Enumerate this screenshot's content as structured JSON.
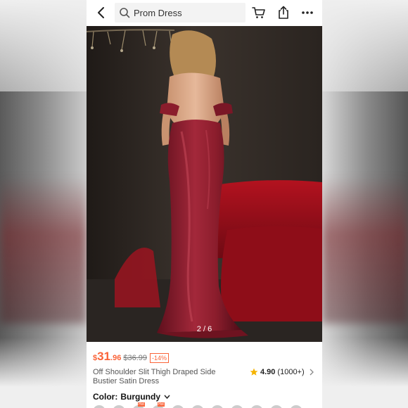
{
  "search": {
    "placeholder": "Prom Dress",
    "value": "Prom Dress"
  },
  "icons": {
    "back": "back-arrow-icon",
    "search": "search-icon",
    "cart": "cart-icon",
    "share": "share-icon",
    "more": "more-icon"
  },
  "gallery": {
    "page_indicator": "2 / 6"
  },
  "product": {
    "price_currency": "$",
    "price_integer": "31",
    "price_decimal": ".96",
    "original_price": "$36.99",
    "discount": "-14%",
    "title": "Off Shoulder Slit Thigh Draped Side Bustier Satin Dress",
    "rating": "4.90",
    "rating_count": "(1000+)",
    "color_label": "Color:",
    "color_value": "Burgundy"
  },
  "swatches": [
    {
      "hot": ""
    },
    {
      "hot": ""
    },
    {
      "hot": "Hot"
    },
    {
      "hot": "Hot"
    },
    {
      "hot": ""
    },
    {
      "hot": ""
    },
    {
      "hot": ""
    },
    {
      "hot": ""
    },
    {
      "hot": ""
    },
    {
      "hot": ""
    },
    {
      "hot": ""
    }
  ],
  "colors": {
    "accent": "#fa6338",
    "star": "#f5b301",
    "dress": "#8b1d2c"
  }
}
